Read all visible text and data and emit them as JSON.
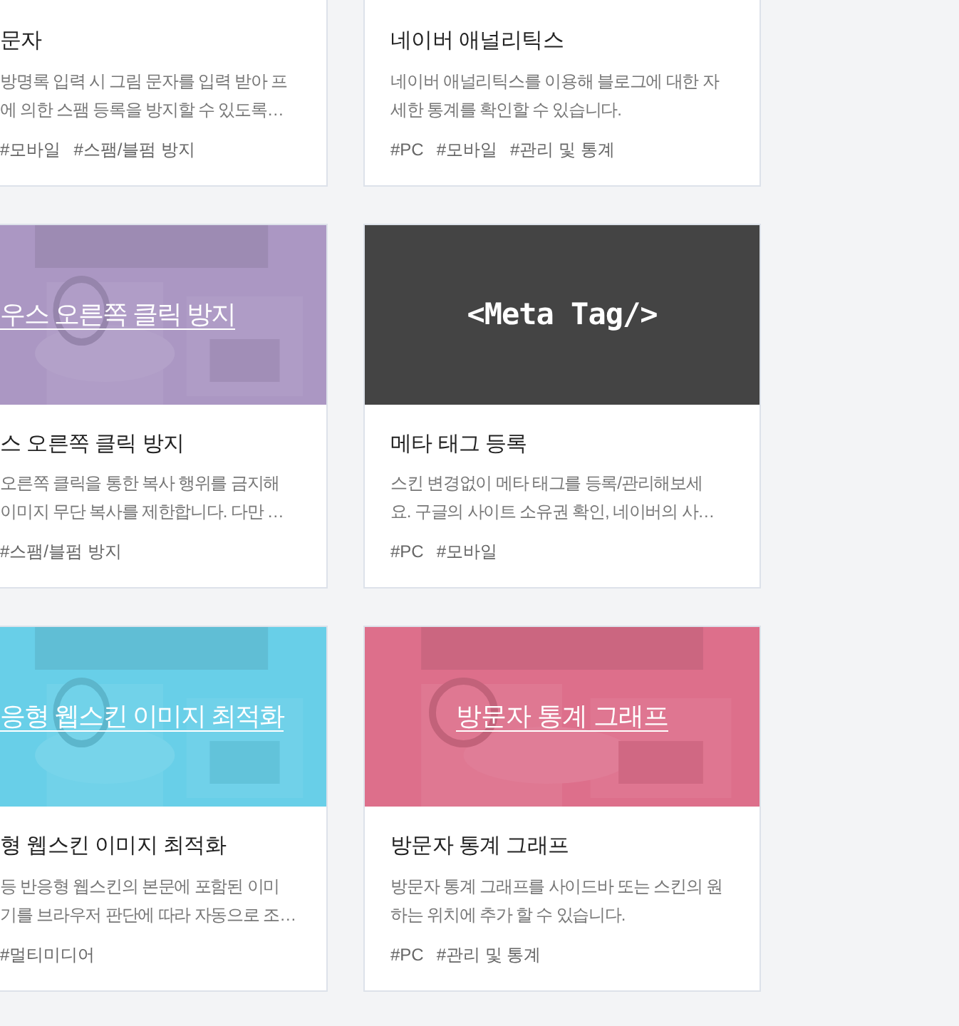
{
  "rows": [
    {
      "cards": [
        {
          "title": "문자",
          "description": [
            "방명록 입력 시 그림 문자를 입력 받아 프",
            "에 의한 스팸 등록을 방지할 수 있도록…"
          ],
          "tags": [
            "#모바일",
            "#스팸/블펌 방지"
          ]
        },
        {
          "title": "네이버 애널리틱스",
          "description": [
            "네이버 애널리틱스를 이용해 블로그에 대한 자",
            "세한 통계를 확인할 수 있습니다."
          ],
          "tags": [
            "#PC",
            "#모바일",
            "#관리 및 통계"
          ]
        }
      ]
    },
    {
      "cards": [
        {
          "banner": {
            "kind": "picture",
            "text": "우스 오른쪽 클릭 방지",
            "color": "#ab97c3"
          },
          "title": "스 오른쪽 클릭 방지",
          "description": [
            "오른쪽 클릭을 통한 복사 행위를 금지해",
            "이미지 무단 복사를 제한합니다. 다만 …"
          ],
          "tags": [
            "#스팸/블펌 방지"
          ]
        },
        {
          "banner": {
            "kind": "code",
            "text": "<Meta Tag/>",
            "color": "#444444"
          },
          "title": "메타 태그 등록",
          "description": [
            "스킨 변경없이 메타 태그를 등록/관리해보세",
            "요. 구글의 사이트 소유권 확인, 네이버의 사…"
          ],
          "tags": [
            "#PC",
            "#모바일"
          ]
        }
      ]
    },
    {
      "cards": [
        {
          "banner": {
            "kind": "picture",
            "text": "응형 웹스킨 이미지 최적화",
            "color": "#68cfe8"
          },
          "title": "형 웹스킨 이미지 최적화",
          "description": [
            "등 반응형 웹스킨의 본문에 포함된 이미",
            "기를 브라우저 판단에 따라 자동으로 조…"
          ],
          "tags": [
            "#멀티미디어"
          ]
        },
        {
          "banner": {
            "kind": "picture",
            "text": "방문자 통계 그래프",
            "color": "#dd6f8b"
          },
          "title": "방문자 통계 그래프",
          "description": [
            "방문자 통계 그래프를 사이드바 또는 스킨의 원",
            "하는 위치에 추가 할 수 있습니다."
          ],
          "tags": [
            "#PC",
            "#관리 및 통계"
          ]
        }
      ]
    }
  ]
}
